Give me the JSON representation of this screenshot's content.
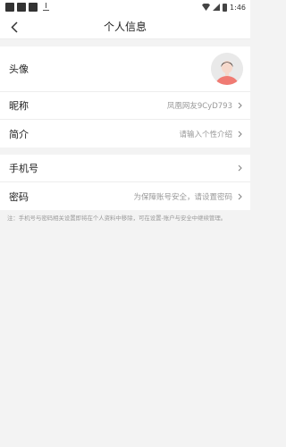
{
  "status_bar": {
    "time": "1:46"
  },
  "header": {
    "title": "个人信息"
  },
  "profile": {
    "avatar_label": "头像",
    "nickname_label": "昵称",
    "nickname_value": "凤凰网友9CyD793",
    "bio_label": "简介",
    "bio_placeholder": "请输入个性介绍"
  },
  "account": {
    "phone_label": "手机号",
    "phone_value": "",
    "password_label": "密码",
    "password_value": "为保障账号安全，请设置密码"
  },
  "note": "注：手机号与密码相关设置即将在个人资料中移除，可在设置-账户与安全中继续管理。",
  "colors": {
    "avatar_body": "#f07b73",
    "avatar_bg": "#e9e9e9"
  },
  "icons": [
    "back-arrow-icon",
    "chevron-right-icon",
    "avatar-icon"
  ]
}
